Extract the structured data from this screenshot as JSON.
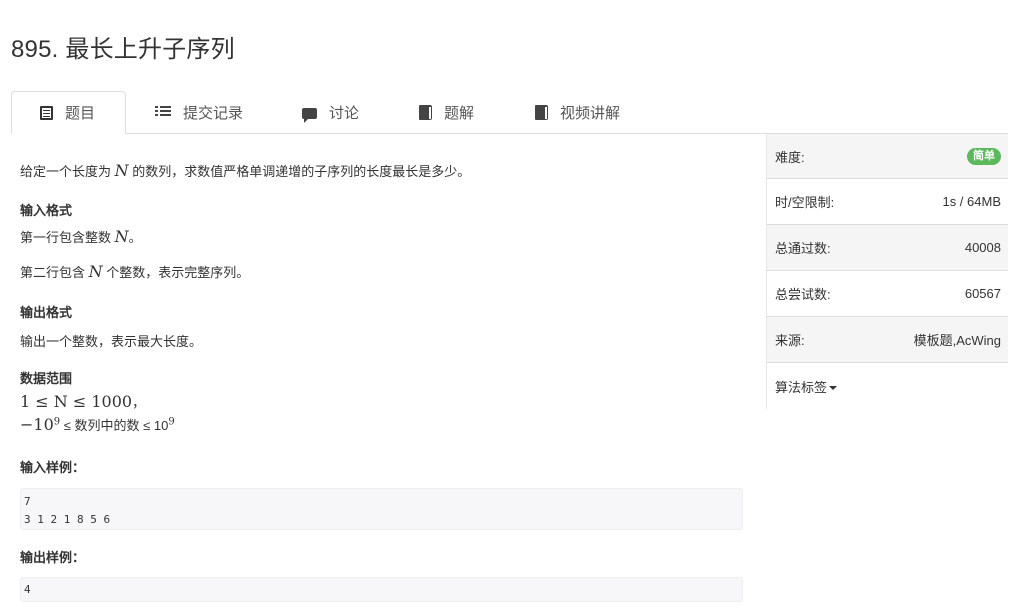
{
  "problem": {
    "title": "895. 最长上升子序列"
  },
  "tabs": [
    {
      "label": "题目",
      "icon": "document-icon"
    },
    {
      "label": "提交记录",
      "icon": "list-icon"
    },
    {
      "label": "讨论",
      "icon": "comment-icon"
    },
    {
      "label": "题解",
      "icon": "book-icon"
    },
    {
      "label": "视频讲解",
      "icon": "book-icon"
    }
  ],
  "statement": {
    "desc_pre": "给定一个长度为",
    "desc_var": "N",
    "desc_post": "的数列，求数值严格单调递增的子序列的长度最长是多少。",
    "input_heading": "输入格式",
    "input_line1_pre": "第一行包含整数",
    "input_line1_var": "N",
    "input_line1_post": "。",
    "input_line2_pre": "第二行包含",
    "input_line2_var": "N",
    "input_line2_post": "个整数，表示完整序列。",
    "output_heading": "输出格式",
    "output_line": "输出一个整数，表示最大长度。",
    "range_heading": "数据范围",
    "range_line1": "1 ≤ N ≤ 1000",
    "range_line1_suffix": "，",
    "range_line2_pre": "−10",
    "range_line2_exp": "9",
    "range_line2_mid": "≤ 数列中的数 ≤ 10",
    "range_line2_exp2": "9",
    "sample_in_heading": "输入样例：",
    "sample_in": "7\n3 1 2 1 8 5 6",
    "sample_out_heading": "输出样例：",
    "sample_out": "4"
  },
  "sidebar": {
    "difficulty_label": "难度:",
    "difficulty_value": "简单",
    "difficulty_color": "#5cb85c",
    "limit_label": "时/空限制:",
    "limit_value": "1s / 64MB",
    "passed_label": "总通过数:",
    "passed_value": "40008",
    "tried_label": "总尝试数:",
    "tried_value": "60567",
    "source_label": "来源:",
    "source_value": "模板题,AcWing",
    "tags_label": "算法标签"
  }
}
